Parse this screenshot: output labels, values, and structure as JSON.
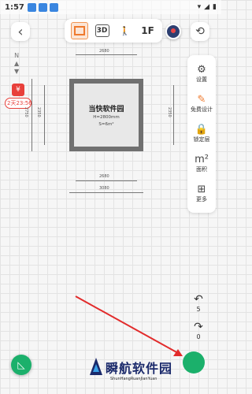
{
  "status_bar": {
    "time": "1:57"
  },
  "toolbar": {
    "floor_label": "1F",
    "three_d_label": "3D"
  },
  "promo": {
    "icon": "¥",
    "timer": "2天23:56"
  },
  "compass": {
    "label": "N"
  },
  "side_menu": [
    {
      "icon": "gear-icon",
      "glyph": "⚙",
      "label": "设置"
    },
    {
      "icon": "design-icon",
      "glyph": "✎",
      "label": "免费设计"
    },
    {
      "icon": "lock-icon",
      "glyph": "🔒",
      "label": "锁定层"
    },
    {
      "icon": "area-icon",
      "glyph": "m²",
      "label": "面积"
    },
    {
      "icon": "grid-more-icon",
      "glyph": "⊞",
      "label": "更多"
    }
  ],
  "room": {
    "name": "当快软件园",
    "height": "H=2800mm",
    "area": "S=6m²"
  },
  "dimensions": {
    "top": "2680",
    "bottom_inner": "2680",
    "bottom_outer": "3080",
    "left_outer": "2750",
    "left_inner": "2350",
    "right_inner": "2350"
  },
  "undo": {
    "undo_count": "5",
    "redo_count": "0"
  },
  "watermark": {
    "title": "瞬航软件园",
    "subtitle": "ShunHangRuanJianYuan"
  },
  "colors": {
    "accent": "#ef7a2e",
    "green": "#1bb06b",
    "wall": "#707070"
  }
}
